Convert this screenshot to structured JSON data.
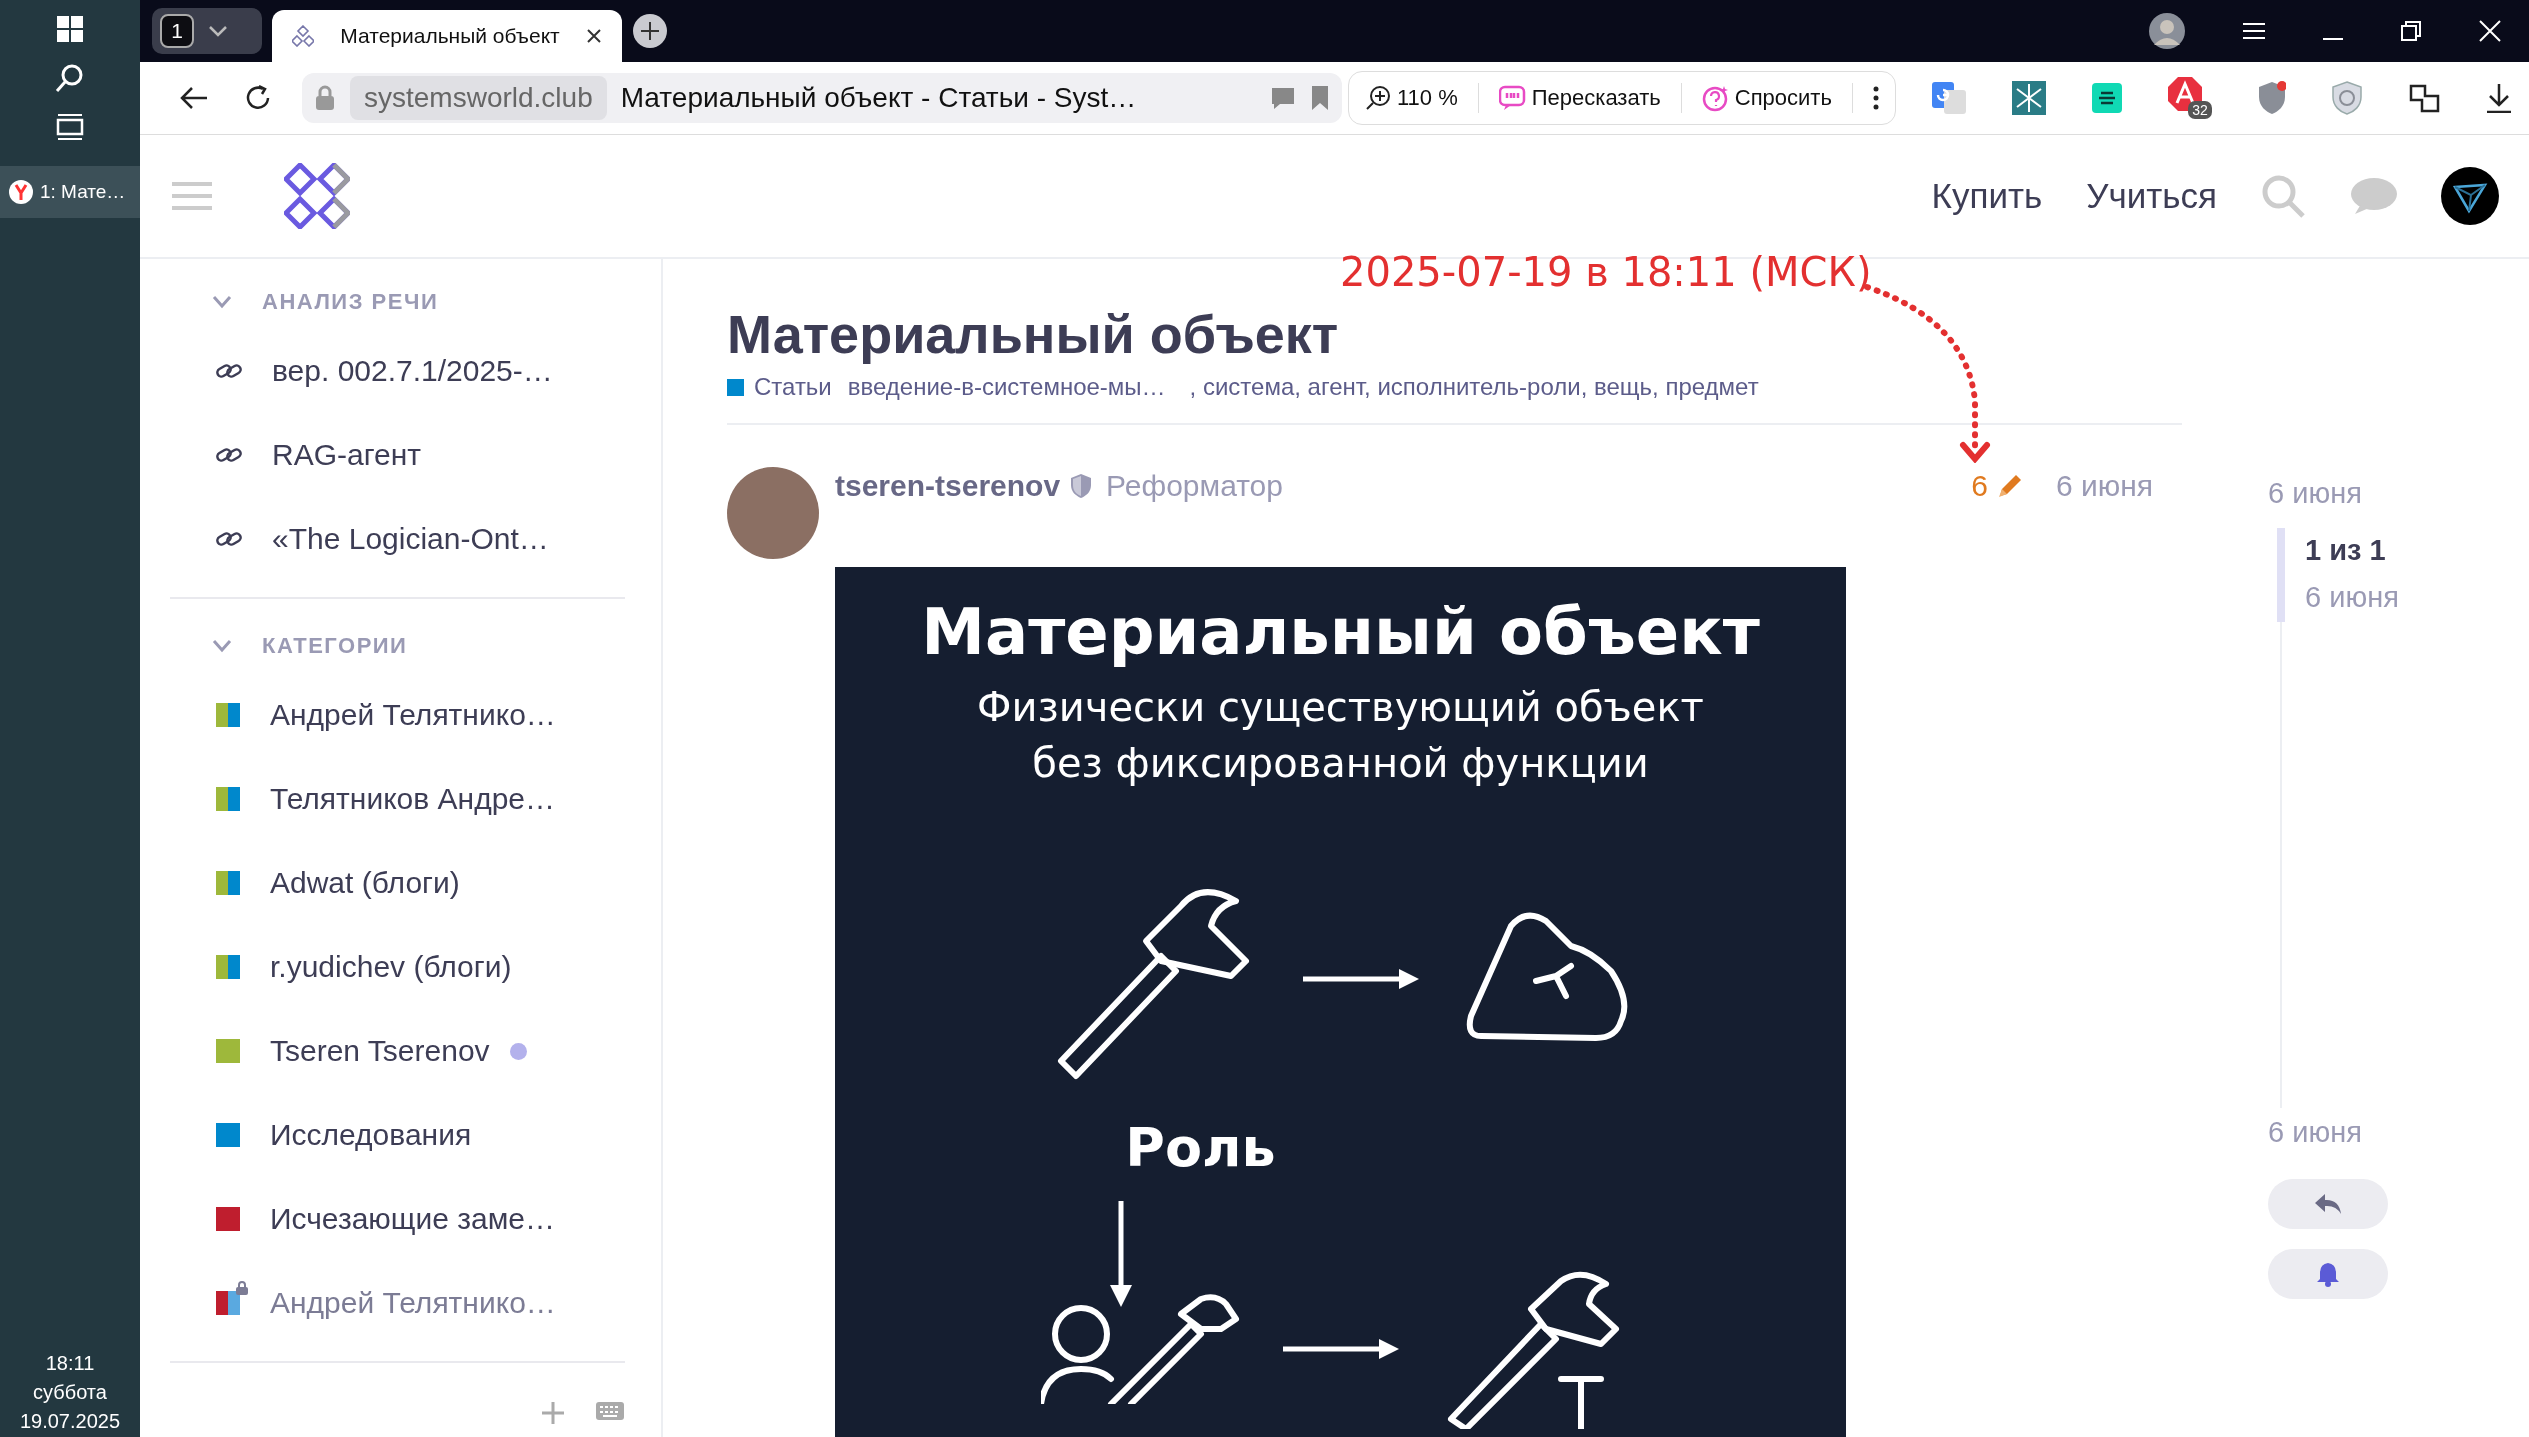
{
  "taskbar": {
    "task_button": "1: Мате…",
    "clock": {
      "time": "18:11",
      "weekday": "суббота",
      "date": "19.07.2025"
    }
  },
  "browser": {
    "tab_counter": "1",
    "tabs": [
      {
        "title": "Материальный объект",
        "selected": true
      }
    ],
    "address": {
      "domain": "systemsworld.club",
      "page_title": "Материальный объект - Статьи - Syst…"
    },
    "zoom": "110 %",
    "actions": [
      "Пересказать",
      "Спросить"
    ],
    "extension_badge": "32"
  },
  "header": {
    "nav": [
      "Купить",
      "Учиться"
    ]
  },
  "sidebar": {
    "sections": [
      {
        "title": "АНАЛИЗ РЕЧИ",
        "expanded": true,
        "items": [
          {
            "kind": "link",
            "label": "вер. 002.7.1/2025-…"
          },
          {
            "kind": "link",
            "label": "RAG-агент"
          },
          {
            "kind": "link",
            "label": "«The Logician-Ont…"
          }
        ]
      },
      {
        "title": "КАТЕГОРИИ",
        "expanded": true,
        "items": [
          {
            "kind": "category",
            "label": "Андрей Телятнико…",
            "swatches": [
              {
                "color": "#9eb83b"
              },
              {
                "color": "#0088cc"
              }
            ],
            "new": false,
            "locked": false
          },
          {
            "kind": "category",
            "label": "Телятников Андре…",
            "swatches": [
              {
                "color": "#9eb83b"
              },
              {
                "color": "#0088cc"
              }
            ],
            "new": false,
            "locked": false
          },
          {
            "kind": "category",
            "label": "Adwat (блоги)",
            "swatches": [
              {
                "color": "#9eb83b"
              },
              {
                "color": "#0088cc"
              }
            ],
            "new": false,
            "locked": false
          },
          {
            "kind": "category",
            "label": "r.yudichev (блоги)",
            "swatches": [
              {
                "color": "#9eb83b"
              },
              {
                "color": "#0088cc"
              }
            ],
            "new": false,
            "locked": false
          },
          {
            "kind": "category",
            "label": "Tseren Tserenov",
            "swatches": [
              {
                "color": "#9eb83b"
              }
            ],
            "new": true,
            "locked": false
          },
          {
            "kind": "category",
            "label": "Исследования",
            "swatches": [
              {
                "color": "#0088cc"
              }
            ],
            "new": false,
            "locked": false
          },
          {
            "kind": "category",
            "label": "Исчезающие заме…",
            "swatches": [
              {
                "color": "#bf1e2e"
              }
            ],
            "new": false,
            "locked": false
          },
          {
            "kind": "category",
            "label": "Андрей Телятнико…",
            "swatches": [
              {
                "color": "#bf1e2e"
              },
              {
                "color": "#5aa9e0"
              }
            ],
            "new": false,
            "locked": true
          }
        ]
      }
    ]
  },
  "topic": {
    "title": "Материальный объект",
    "category": {
      "label": "Статьи",
      "color": "#0088cc"
    },
    "tags": [
      "введение-в-системное-мы…",
      ", система, агент, исполнитель-роли, вещь, предмет"
    ],
    "post": {
      "author": "tseren-tserenov",
      "user_title": "Реформатор",
      "edits": "6",
      "date": "6 июня",
      "image": {
        "title": "Материальный объект",
        "subtitle": [
          "Физически существующий объект",
          "без фиксированной функции"
        ],
        "caption": "Роль"
      }
    }
  },
  "timeline": {
    "start": "6 июня",
    "position": "1 из 1",
    "position_date": "6 июня",
    "end": "6 июня"
  },
  "annotation": "2025-07-19 в 18:11 (МСК)"
}
